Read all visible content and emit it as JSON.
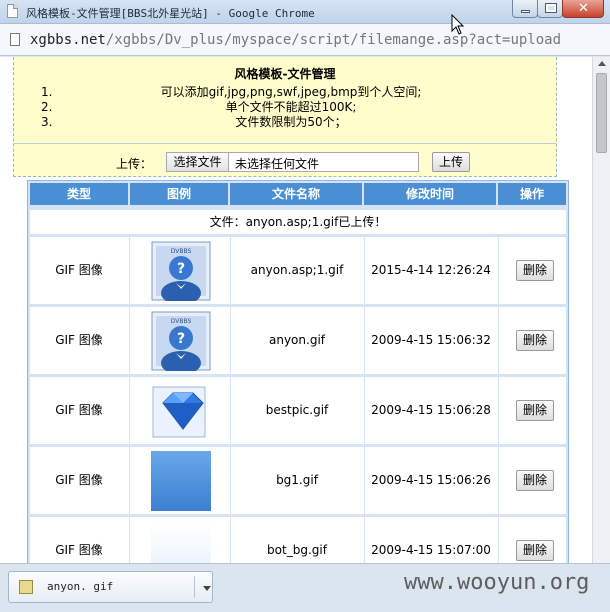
{
  "window": {
    "title": "风格模板-文件管理[BBS北外星光站] - Google Chrome"
  },
  "address": {
    "host": "xgbbs.net",
    "path": "/xgbbs/Dv_plus/myspace/script/filemange.asp?act=upload"
  },
  "info": {
    "heading": "风格模板-文件管理",
    "rules": [
      {
        "num": "1.",
        "text": "可以添加gif,jpg,png,swf,jpeg,bmp到个人空间;"
      },
      {
        "num": "2.",
        "text": "单个文件不能超过100K;"
      },
      {
        "num": "3.",
        "text": "文件数限制为50个；"
      }
    ]
  },
  "upload": {
    "label": "上传：",
    "choose_label": "选择文件",
    "no_file_label": "未选择任何文件",
    "submit_label": "上传"
  },
  "table": {
    "headers": [
      "类型",
      "图例",
      "文件名称",
      "修改时间",
      "操作"
    ],
    "message": "文件：anyon.asp;1.gif已上传！",
    "rows": [
      {
        "type": "GIF 图像",
        "thumb": "dvbbs-avatar",
        "name": "anyon.asp;1.gif",
        "time": "2015-4-14 12:26:24",
        "action": "删除"
      },
      {
        "type": "GIF 图像",
        "thumb": "dvbbs-avatar",
        "name": "anyon.gif",
        "time": "2009-4-15 15:06:32",
        "action": "删除"
      },
      {
        "type": "GIF 图像",
        "thumb": "diamond",
        "name": "bestpic.gif",
        "time": "2009-4-15 15:06:28",
        "action": "删除"
      },
      {
        "type": "GIF 图像",
        "thumb": "blue-gradient",
        "name": "bg1.gif",
        "time": "2009-4-15 15:06:26",
        "action": "删除"
      },
      {
        "type": "GIF 图像",
        "thumb": "light-gradient",
        "name": "bot_bg.gif",
        "time": "2009-4-15 15:07:00",
        "action": "删除"
      }
    ]
  },
  "download": {
    "filename": "anyon. gif"
  },
  "watermark": "www.wooyun.org",
  "colors": {
    "header_blue": "#4a8fd4",
    "info_yellow": "#fffdcc",
    "table_border": "#96b5dc"
  }
}
